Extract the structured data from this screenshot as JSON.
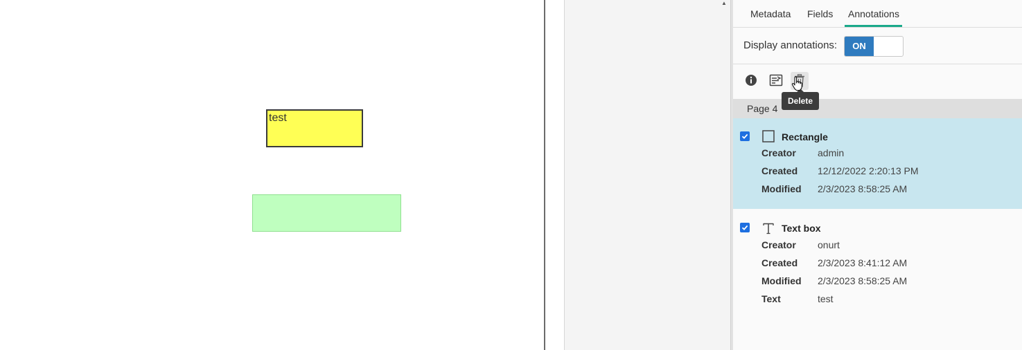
{
  "document": {
    "text_box_content": "test"
  },
  "panel": {
    "tabs": [
      {
        "label": "Metadata",
        "active": false
      },
      {
        "label": "Fields",
        "active": false
      },
      {
        "label": "Annotations",
        "active": true
      }
    ],
    "display_annotations_label": "Display annotations:",
    "toggle_state": "ON",
    "toolbar": {
      "info_icon": "info-icon",
      "properties_icon": "properties-icon",
      "delete_icon": "trash-icon",
      "tooltip": "Delete"
    },
    "page_header": "Page 4",
    "annotations": [
      {
        "type_icon": "square-icon",
        "title": "Rectangle",
        "checked": true,
        "selected": true,
        "props": [
          {
            "label": "Creator",
            "value": "admin"
          },
          {
            "label": "Created",
            "value": "12/12/2022 2:20:13 PM"
          },
          {
            "label": "Modified",
            "value": "2/3/2023 8:58:25 AM"
          }
        ]
      },
      {
        "type_icon": "text-icon",
        "title": "Text box",
        "checked": true,
        "selected": false,
        "props": [
          {
            "label": "Creator",
            "value": "onurt"
          },
          {
            "label": "Created",
            "value": "2/3/2023 8:41:12 AM"
          },
          {
            "label": "Modified",
            "value": "2/3/2023 8:58:25 AM"
          },
          {
            "label": "Text",
            "value": "test"
          }
        ]
      }
    ]
  },
  "colors": {
    "accent": "#1aa98a",
    "toggle_on": "#2f7bbf",
    "selected_row": "#c8e6ef",
    "text_box_fill": "#ffff55",
    "rectangle_fill": "#bfffbf"
  }
}
